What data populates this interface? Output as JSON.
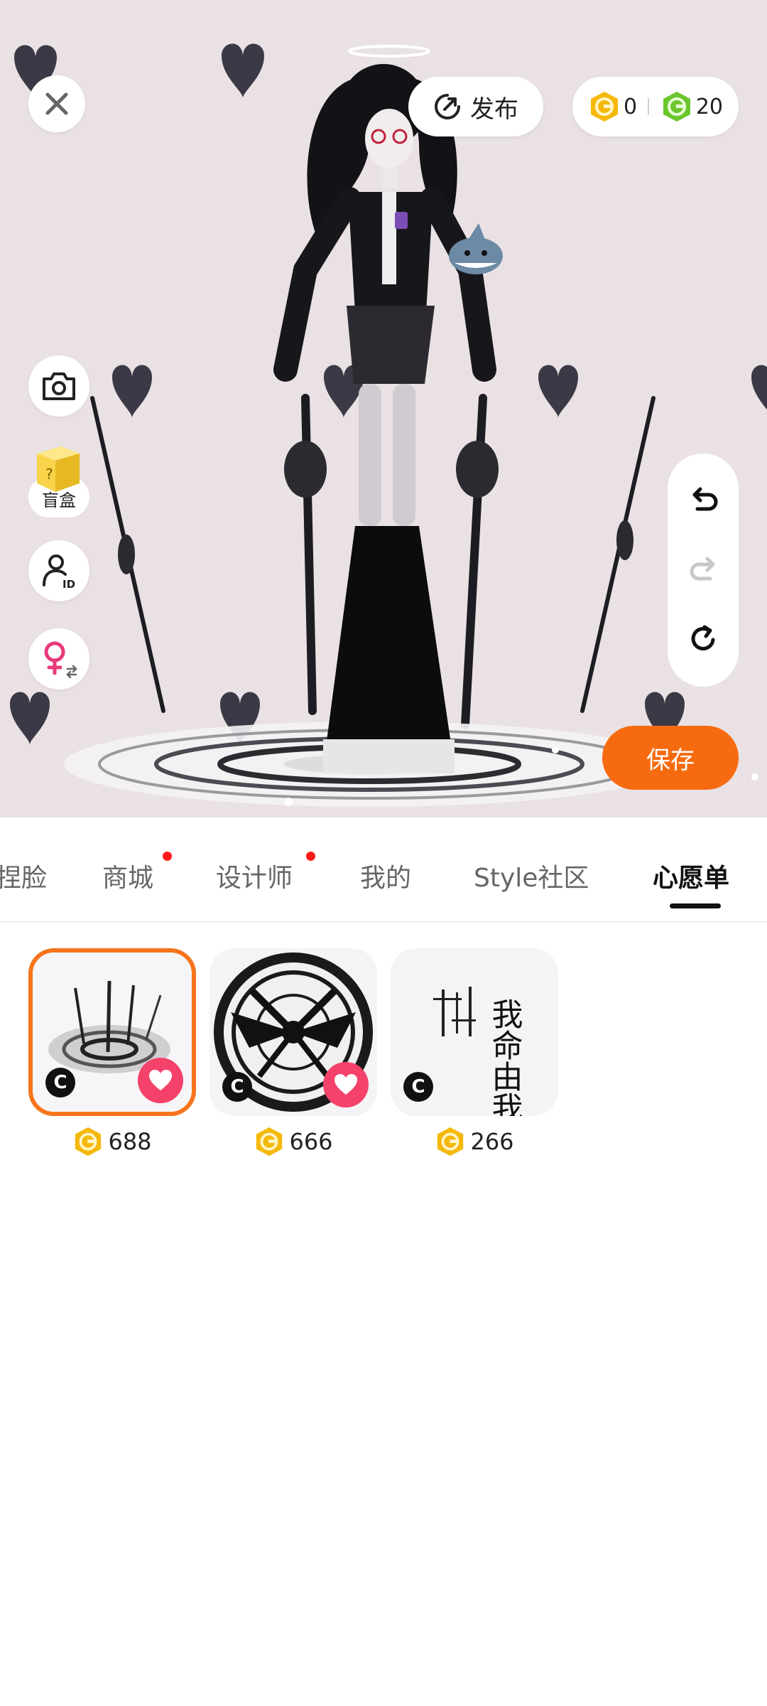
{
  "top_bar": {
    "publish_label": "发布",
    "gold_coins": "0",
    "green_coins": "20"
  },
  "left_tools": {
    "blind_box_label": "盲盒"
  },
  "save_label": "保存",
  "tabs": [
    {
      "label": "捏脸",
      "active": false,
      "has_dot": false
    },
    {
      "label": "商城",
      "active": false,
      "has_dot": true
    },
    {
      "label": "设计师",
      "active": false,
      "has_dot": true
    },
    {
      "label": "我的",
      "active": false,
      "has_dot": false
    },
    {
      "label": "Style社区",
      "active": false,
      "has_dot": false
    },
    {
      "label": "心愿单",
      "active": true,
      "has_dot": false
    }
  ],
  "wishlist_items": [
    {
      "price": "688",
      "selected": true,
      "favorited": true
    },
    {
      "price": "666",
      "selected": false,
      "favorited": true
    },
    {
      "price": "266",
      "selected": false,
      "favorited": false
    }
  ],
  "item_badge_letter": "C",
  "calligraphy_text": "我命由我不由天",
  "colors": {
    "accent_orange": "#f76b10",
    "heart_pink": "#f5426b",
    "coin_gold": "#f5b90c",
    "coin_green": "#6cc62e",
    "stage_bg": "#e9e1e3",
    "tab_dot": "#ff1a1a"
  }
}
